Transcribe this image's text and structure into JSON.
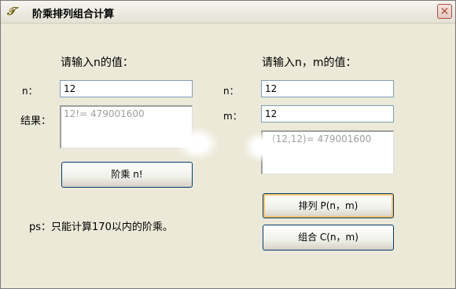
{
  "window": {
    "title": "阶乘排列组合计算",
    "close_glyph": "✕"
  },
  "left": {
    "heading": "请输入n的值：",
    "n_label": "n：",
    "n_value": "12",
    "result_label": "结果：",
    "result_value": "12!= 479001600",
    "factorial_button": "阶乘 n!"
  },
  "right": {
    "heading": "请输入n，m的值：",
    "n_label": "n：",
    "n_value": "12",
    "m_label": "m：",
    "m_value": "12",
    "result_value": "(12,12)= 479001600",
    "permutation_button": "排列 P(n，m)",
    "combination_button": "组合 C(n，m)"
  },
  "note": "ps：只能计算170以内的阶乘。",
  "colors": {
    "background": "#ece9d8",
    "input_border": "#7f9db9",
    "button_border": "#003c74",
    "result_text": "#a0a0a0",
    "close_red": "#b25041"
  }
}
